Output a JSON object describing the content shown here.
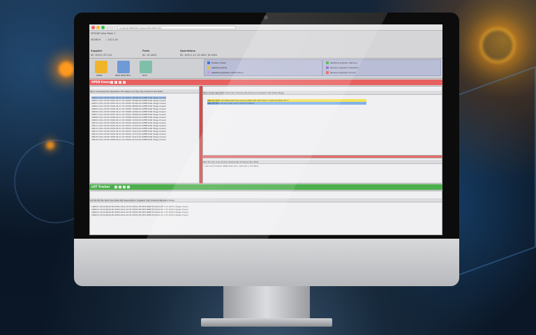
{
  "browser": {
    "nav_back": "‹",
    "nav_forward": "›",
    "url": "localhost:8080/PO-tracker/?PO-POQ=QT",
    "dots": [
      "#f2605a",
      "#f8bd2f",
      "#30c643"
    ]
  },
  "app": {
    "menu": "VPOQM  View  Tools  ?",
    "search_label": "SEARCH",
    "search_value": "1011-45",
    "headers": [
      "Supplier",
      "Parts",
      "Operations"
    ],
    "header_values": [
      "ID: 10511 ST-110",
      "ID: 10-4001",
      "ID: 10511-12 10-4001  ID 4501"
    ],
    "toolbar": [
      {
        "label": "OPEN",
        "color": "#f0b429",
        "icon": "box-icon"
      },
      {
        "label": "NEW REQUEST",
        "color": "#6e9ad6",
        "icon": "document-icon"
      },
      {
        "label": "IDLE",
        "color": "#7fbfa8",
        "icon": "clipboard-icon"
      }
    ],
    "legend_left": [
      {
        "text": "Closed orders",
        "color": "#3d7bd8"
      },
      {
        "text": "Awaiting items",
        "color": "#e8c23a"
      },
      {
        "text": "Awaiting supplier confirmation",
        "color": "#c9a0e0"
      }
    ],
    "legend_right": [
      {
        "text": "Awaiting supplier delivery",
        "color": "#4caf50"
      },
      {
        "text": "Receive supplier inspection",
        "color": "#8d6ec9"
      },
      {
        "text": "Receive supplier invoice",
        "color": "#e85a5a"
      }
    ]
  },
  "open_panel": {
    "title": "OPEN Items",
    "band_color": "#e86060",
    "columns": "Item Code   Part No   Operation   PO status   Lot Qty  Qty Ordered  Del Date",
    "rows": [
      "20001  1011-45 PO 0921  06.11 ST-10501  18/08/16  OVERFLOW  Stage Closed",
      "20002  1011-45 PO 0922  06.11 ST-10502  25/08/16  OVERFLOW  Stage Closed",
      "20003  1011-45 PO 0923  06.11 ST-10503  01/09/16  OVERFLOW  Stage Closed",
      "20004  1011-45 PO 0924  06.11 ST-10504  08/09/16  OVERFLOW  Stage Closed",
      "20005  1011-45 PO 0925  06.11 ST-10505  15/09/16  OVERFLOW  Stage Closed",
      "20006  1011-45 PO 0926  06.11 ST-10506  22/09/16  OVERFLOW  Stage Closed",
      "20007  1011-45 PO 0927  06.11 ST-10507  29/09/16  OVERFLOW  Stage Closed",
      "20008  1011-45 PO 0928  06.11 ST-10508  06/10/16  OVERFLOW  Stage Closed",
      "20009  1011-45 PO 0929  06.11 ST-10509  13/10/16  OVERFLOW  Stage Closed",
      "20010  1011-45 PO 0930  06.11 ST-10510  20/10/16  OVERFLOW  Stage Closed",
      "20011  1011-45 PO 0931  06.11 ST-10511  27/10/16  OVERFLOW  Stage Closed",
      "20012  1011-45 PO 0932  06.11 ST-10512  03/11/16  OVERFLOW  Stage Closed",
      "20013  1011-45 PO 0933  06.11 ST-10513  10/11/16  OVERFLOW  Stage Closed",
      "20014  1011-45 PO 0934  06.11 ST-10514  17/11/16  OVERFLOW  Stage Closed",
      "20015  1011-45 PO 0935  06.11 ST-10515  24/11/16  OVERFLOW  Stage Closed",
      "20016  1011-45 PO 0936  06.11 ST-10516  01/12/16  OVERFLOW  Stage Closed"
    ]
  },
  "detail_panel": {
    "columns": "Item  Code  Operation  Stat  Qty Ordered  Qty Received  Supplier  Del Date  Stage",
    "rows": [
      {
        "text": "AMC-01  1011-45 OPER-4501-Processing-2500-4T5    1011  8/21  7  1/22  ST-10511 ST  1",
        "color": "#f2e25a"
      },
      {
        "text": "AMC-02  1011-45 PO-4502  1/22  4  8/22  ST-10512",
        "color": "#7fb2ea"
      }
    ],
    "sub_columns": "Part No  Qty  Cost  Orders  Detail  Qty Ordered  Qty Total",
    "sub_row": "1011-45 ST-10511  PART-1011-45   1  1011-45  1  ST-10511"
  },
  "lot_panel": {
    "title": "LOT Tracker",
    "band_color": "#4dae4d",
    "columns": "Lot No  PO No  Item  Del Date  Qty  Description  Supplier  Qty Ordered  Receive  Stage",
    "rows": [
      "100011  10/11/2016  PO-4501-1011-45  ST-10511  80 PCS  PART-ST-1011-45  1  ST-10511 Stage Closed",
      "100012  11/11/2016  PO-4502-1011-45  ST-10512  80 PCS  PART-ST-1011-45  1  ST-10512 Stage Closed",
      "100013  12/11/2016  PO-4503-1011-45  ST-10513  80 PCS  PART-ST-1011-45  1  ST-10513 Stage Closed",
      "100014  13/11/2016  PO-4504-1011-45  ST-10514  80 PCS  PART-ST-1011-45  1  ST-10514 Stage Closed"
    ]
  }
}
